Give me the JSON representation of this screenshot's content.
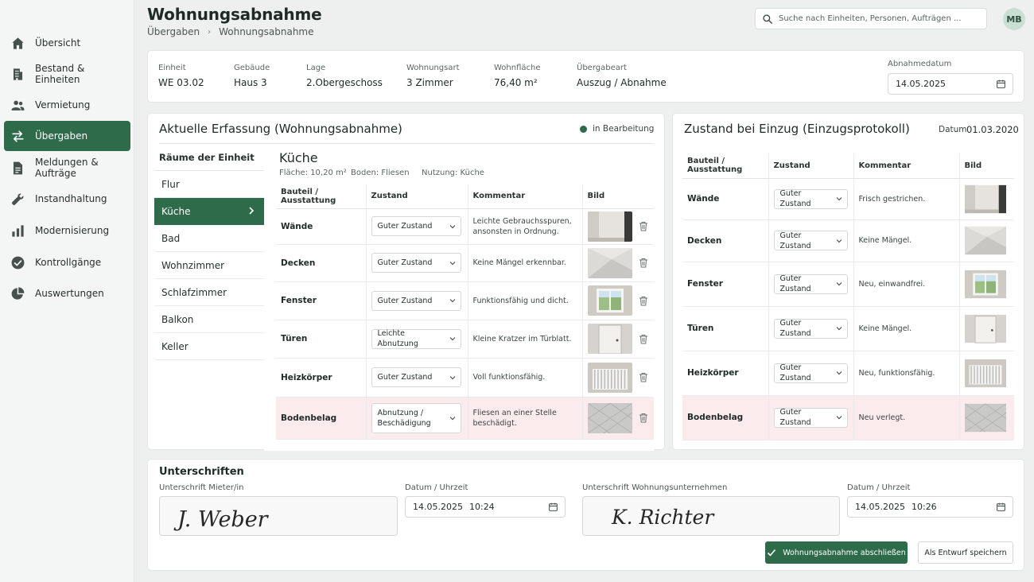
{
  "header": {
    "title": "Wohnungsabnahme",
    "breadcrumb": [
      "Übergaben",
      "Wohnungsabnahme"
    ]
  },
  "search": {
    "placeholder": "Suche nach Einheiten, Personen, Aufträgen ..."
  },
  "user": {
    "initials": "MB"
  },
  "sidebar": {
    "items": [
      {
        "label": "Übersicht",
        "icon": "home-icon",
        "active": false
      },
      {
        "label": "Bestand & Einheiten",
        "icon": "building-icon",
        "active": false
      },
      {
        "label": "Vermietung",
        "icon": "people-icon",
        "active": false
      },
      {
        "label": "Übergaben",
        "icon": "swap-arrows-icon",
        "active": true
      },
      {
        "label": "Meldungen & Aufträge",
        "icon": "document-icon",
        "active": false
      },
      {
        "label": "Instandhaltung",
        "icon": "wrench-icon",
        "active": false
      },
      {
        "label": "Modernisierung",
        "icon": "bar-chart-icon",
        "active": false
      },
      {
        "label": "Kontrollgänge",
        "icon": "check-circle-icon",
        "active": false
      },
      {
        "label": "Auswertungen",
        "icon": "pie-chart-icon",
        "active": false
      }
    ]
  },
  "unit_info": {
    "fields": [
      {
        "label": "Einheit",
        "value": "WE 03.02"
      },
      {
        "label": "Gebäude",
        "value": "Haus 3"
      },
      {
        "label": "Lage",
        "value": "2.Obergeschoss"
      },
      {
        "label": "Wohnungsart",
        "value": "3 Zimmer"
      },
      {
        "label": "Wohnfläche",
        "value": "76,40 m²"
      },
      {
        "label": "Übergabeart",
        "value": "Auszug / Abnahme"
      }
    ],
    "date_label": "Abnahmedatum",
    "date_value": "14.05.2025"
  },
  "current": {
    "title": "Aktuelle Erfassung (Wohnungsabnahme)",
    "status": "in Bearbeitung",
    "status_color": "#2e6b4b",
    "rooms_header": "Räume der Einheit",
    "rooms": [
      "Flur",
      "Küche",
      "Bad",
      "Wohnzimmer",
      "Schlafzimmer",
      "Balkon",
      "Keller"
    ],
    "active_room": "Küche",
    "room_title": "Küche",
    "room_area": "Fläche: 10,20 m²",
    "room_floor": "Boden: Fliesen",
    "room_use": "Nutzung: Küche",
    "columns": [
      "Bauteil / Ausstattung",
      "Zustand",
      "Kommentar",
      "Bild"
    ],
    "rows": [
      {
        "item": "Wände",
        "condition": "Guter Zustand",
        "comment": "Leichte Gebrauchsspuren, ansonsten in Ordnung.",
        "image": "wall-photo",
        "flagged": false
      },
      {
        "item": "Decken",
        "condition": "Guter Zustand",
        "comment": "Keine Mängel erkennbar.",
        "image": "ceiling-photo",
        "flagged": false
      },
      {
        "item": "Fenster",
        "condition": "Guter Zustand",
        "comment": "Funktionsfähig und dicht.",
        "image": "window-photo",
        "flagged": false
      },
      {
        "item": "Türen",
        "condition": "Leichte Abnutzung",
        "comment": "Kleine Kratzer im Türblatt.",
        "image": "door-photo",
        "flagged": false
      },
      {
        "item": "Heizkörper",
        "condition": "Guter Zustand",
        "comment": "Voll funktionsfähig.",
        "image": "radiator-photo",
        "flagged": false
      },
      {
        "item": "Bodenbelag",
        "condition": "Abnutzung / Beschädigung",
        "comment": "Fliesen an einer Stelle beschädigt.",
        "image": "floor-tiles-photo",
        "flagged": true
      }
    ]
  },
  "previous": {
    "title": "Zustand bei Einzug (Einzugsprotokoll)",
    "date_label": "Datum",
    "date_value": "01.03.2020",
    "columns": [
      "Bauteil / Ausstattung",
      "Zustand",
      "Kommentar",
      "Bild"
    ],
    "rows": [
      {
        "item": "Wände",
        "condition": "Guter Zustand",
        "comment": "Frisch gestrichen.",
        "image": "wall-photo",
        "flagged": false
      },
      {
        "item": "Decken",
        "condition": "Guter Zustand",
        "comment": "Keine Mängel.",
        "image": "ceiling-photo",
        "flagged": false
      },
      {
        "item": "Fenster",
        "condition": "Guter Zustand",
        "comment": "Neu, einwandfrei.",
        "image": "window-photo",
        "flagged": false
      },
      {
        "item": "Türen",
        "condition": "Guter Zustand",
        "comment": "Keine Mängel.",
        "image": "door-photo",
        "flagged": false
      },
      {
        "item": "Heizkörper",
        "condition": "Guter Zustand",
        "comment": "Neu, funktionsfähig.",
        "image": "radiator-photo",
        "flagged": false
      },
      {
        "item": "Bodenbelag",
        "condition": "Guter Zustand",
        "comment": "Neu verlegt.",
        "image": "floor-tiles-photo",
        "flagged": true
      }
    ]
  },
  "signatures": {
    "title": "Unterschriften",
    "tenant_label": "Unterschrift Mieter/in",
    "tenant_signature": "J. Weber",
    "tenant_datetime_label": "Datum / Uhrzeit",
    "tenant_date": "14.05.2025",
    "tenant_time": "10:24",
    "company_label": "Unterschrift Wohnungsunternehmen",
    "company_signature": "K. Richter",
    "company_datetime_label": "Datum / Uhrzeit",
    "company_date": "14.05.2025",
    "company_time": "10:26"
  },
  "actions": {
    "complete_label": "Wohnungsabnahme abschließen",
    "draft_label": "Als Entwurf speichern"
  },
  "colors": {
    "accent": "#2e6b4b",
    "flag_row": "#fcebec"
  }
}
